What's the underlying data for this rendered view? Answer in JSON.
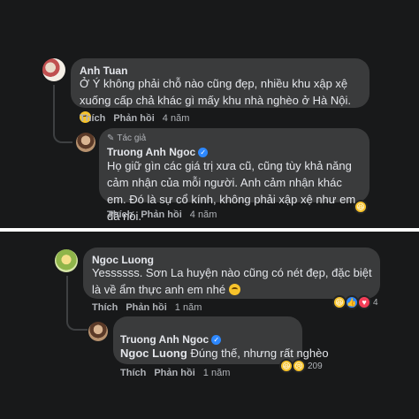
{
  "top": {
    "comment": {
      "author": "Anh Tuan",
      "text": "Ở Ý không phải chỗ nào cũng đẹp, nhiều khu xập xệ xuống cấp chả khác gì mấy khu nhà nghèo ở Hà Nội.",
      "like": "Thích",
      "reply": "Phản hồi",
      "time": "4 năm"
    },
    "reply": {
      "tag": "Tác giả",
      "author": "Truong Anh Ngoc",
      "text": "Họ giữ gìn các giá trị xưa cũ, cũng tùy khả năng cảm nhận của mỗi người. Anh cảm nhận khác em. Đó là sự cổ kính, không phải xập xệ như em đã nói.",
      "like": "Thích",
      "reply": "Phản hồi",
      "time": "4 năm"
    }
  },
  "bottom": {
    "comment": {
      "author": "Ngoc Luong",
      "text": "Yessssss. Sơn La huyện nào cũng có nét đẹp, đặc biệt là về ẩm thực anh em nhé",
      "like": "Thích",
      "reply": "Phản hồi",
      "time": "1 năm",
      "reaction_count": "4"
    },
    "reply": {
      "author": "Truong Anh Ngoc",
      "mention": "Ngoc Luong",
      "text": "Đúng thế, nhưng rất nghèo",
      "like": "Thích",
      "reply": "Phản hồi",
      "time": "1 năm",
      "reaction_count": "209"
    }
  },
  "colors": {
    "background": "#18191a",
    "bubble": "#3a3b3c",
    "verified": "#2d88ff",
    "separator": "#ffffff"
  }
}
